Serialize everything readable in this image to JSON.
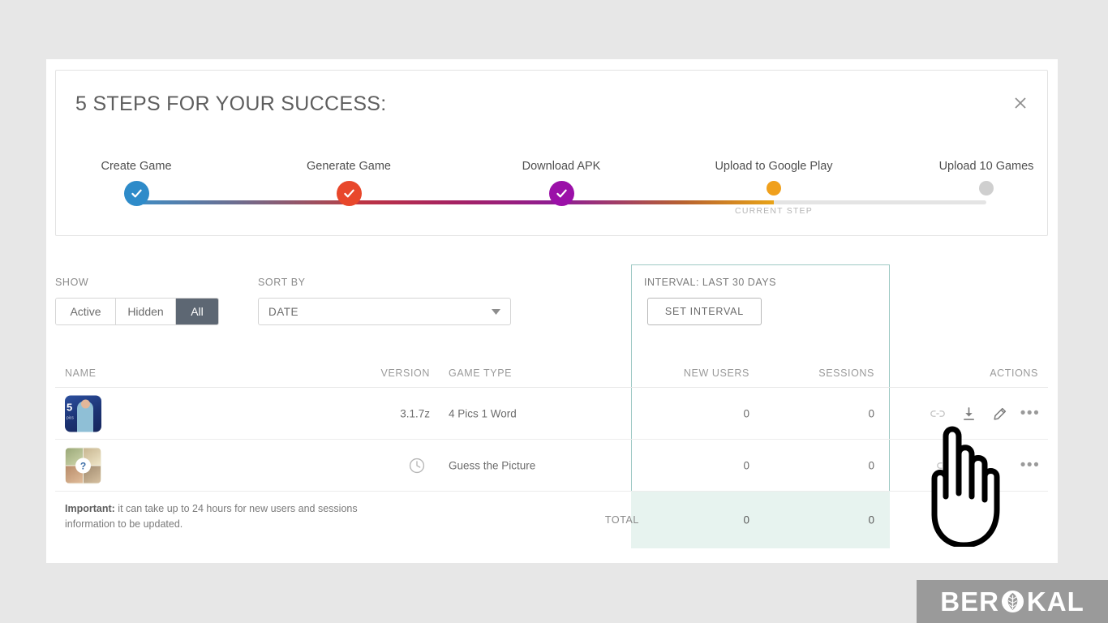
{
  "theme": {
    "page_bg": "#e7e7e7",
    "panel_bg": "#ffffff",
    "accent_selected": "#5d6773",
    "interval_border": "#9ec9c4",
    "total_band_bg": "#e7f3ef",
    "step_colors": [
      "#2e8bc9",
      "#e8472b",
      "#9b10a8",
      "#f0a01c",
      "#cfcfcf"
    ]
  },
  "steps_card": {
    "title": "5 STEPS FOR YOUR SUCCESS:",
    "close_label": "×",
    "close_icon": "close-icon",
    "current_step_caption": "CURRENT STEP",
    "steps": [
      {
        "label": "Create Game",
        "state": "done",
        "icon": "check-icon",
        "color": "#2e8bc9"
      },
      {
        "label": "Generate Game",
        "state": "done",
        "icon": "check-icon",
        "color": "#e8472b"
      },
      {
        "label": "Download APK",
        "state": "done",
        "icon": "check-icon",
        "color": "#9b10a8"
      },
      {
        "label": "Upload to Google Play",
        "state": "current",
        "icon": "dot-icon",
        "color": "#f0a01c"
      },
      {
        "label": "Upload 10 Games",
        "state": "pending",
        "icon": "dot-icon",
        "color": "#cfcfcf"
      }
    ]
  },
  "filters": {
    "show_label": "SHOW",
    "show_options": [
      "Active",
      "Hidden",
      "All"
    ],
    "show_selected": "All",
    "sortby_label": "SORT BY",
    "sortby_value": "DATE",
    "sortby_icon": "chevron-down-icon",
    "interval_label": "INTERVAL: LAST 30 DAYS",
    "set_interval_label": "SET INTERVAL"
  },
  "table": {
    "headers": {
      "name": "NAME",
      "version": "VERSION",
      "game_type": "GAME TYPE",
      "new_users": "NEW USERS",
      "sessions": "SESSIONS",
      "actions": "ACTIONS"
    },
    "rows": [
      {
        "thumbnail": "game-thumbnail-blue-person",
        "thumb_number": "5",
        "thumb_caption": "pics",
        "version": "3.1.7z",
        "version_icon": "",
        "game_type": "4 Pics 1 Word",
        "new_users": "0",
        "sessions": "0",
        "actions": [
          "link-icon",
          "download-icon",
          "edit-pencil-icon",
          "more-options-icon"
        ]
      },
      {
        "thumbnail": "game-thumbnail-photo-grid",
        "thumb_number": "",
        "thumb_caption": "?",
        "version": "",
        "version_icon": "clock-icon",
        "game_type": "Guess the Picture",
        "new_users": "0",
        "sessions": "0",
        "actions": [
          "link-icon",
          "more-options-icon"
        ]
      }
    ],
    "footer": {
      "important_bold": "Important:",
      "important_text": " it can take up to 24 hours for new users and sessions information to be updated.",
      "total_label": "TOTAL",
      "total_new_users": "0",
      "total_sessions": "0"
    }
  },
  "cursor": {
    "name": "hand-cursor-pointer"
  },
  "watermark": {
    "text_left": "BER",
    "text_right": "KAL",
    "icon": "leaf-circle-icon"
  }
}
